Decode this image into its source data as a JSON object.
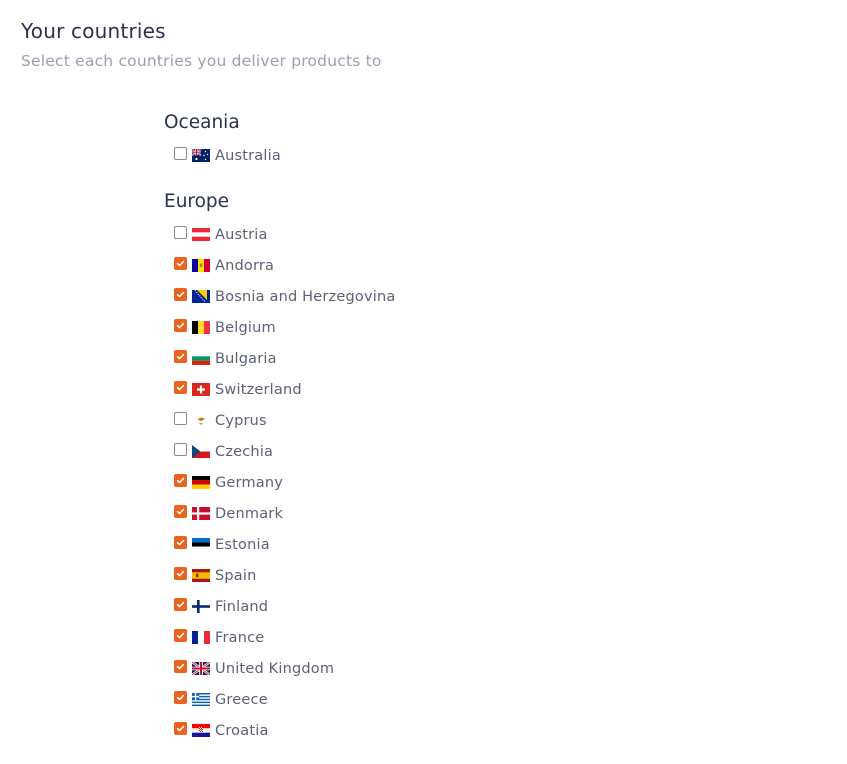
{
  "page": {
    "title": "Your countries",
    "subtitle": "Select each countries you deliver products to"
  },
  "regions": [
    {
      "name": "Oceania",
      "countries": [
        {
          "name": "Australia",
          "checked": false,
          "flag": "australia-flag"
        }
      ]
    },
    {
      "name": "Europe",
      "countries": [
        {
          "name": "Austria",
          "checked": false,
          "flag": "austria-flag"
        },
        {
          "name": "Andorra",
          "checked": true,
          "flag": "andorra-flag"
        },
        {
          "name": "Bosnia and Herzegovina",
          "checked": true,
          "flag": "bosnia-flag"
        },
        {
          "name": "Belgium",
          "checked": true,
          "flag": "belgium-flag"
        },
        {
          "name": "Bulgaria",
          "checked": true,
          "flag": "bulgaria-flag"
        },
        {
          "name": "Switzerland",
          "checked": true,
          "flag": "switzerland-flag"
        },
        {
          "name": "Cyprus",
          "checked": false,
          "flag": "cyprus-flag"
        },
        {
          "name": "Czechia",
          "checked": false,
          "flag": "czechia-flag"
        },
        {
          "name": "Germany",
          "checked": true,
          "flag": "germany-flag"
        },
        {
          "name": "Denmark",
          "checked": true,
          "flag": "denmark-flag"
        },
        {
          "name": "Estonia",
          "checked": true,
          "flag": "estonia-flag"
        },
        {
          "name": "Spain",
          "checked": true,
          "flag": "spain-flag"
        },
        {
          "name": "Finland",
          "checked": true,
          "flag": "finland-flag"
        },
        {
          "name": "France",
          "checked": true,
          "flag": "france-flag"
        },
        {
          "name": "United Kingdom",
          "checked": true,
          "flag": "uk-flag"
        },
        {
          "name": "Greece",
          "checked": true,
          "flag": "greece-flag"
        },
        {
          "name": "Croatia",
          "checked": true,
          "flag": "croatia-flag"
        }
      ]
    }
  ],
  "colors": {
    "accent": "#e8641f",
    "title": "#2c3150",
    "subtitle": "#9aa0b4",
    "label": "#5d6178"
  }
}
